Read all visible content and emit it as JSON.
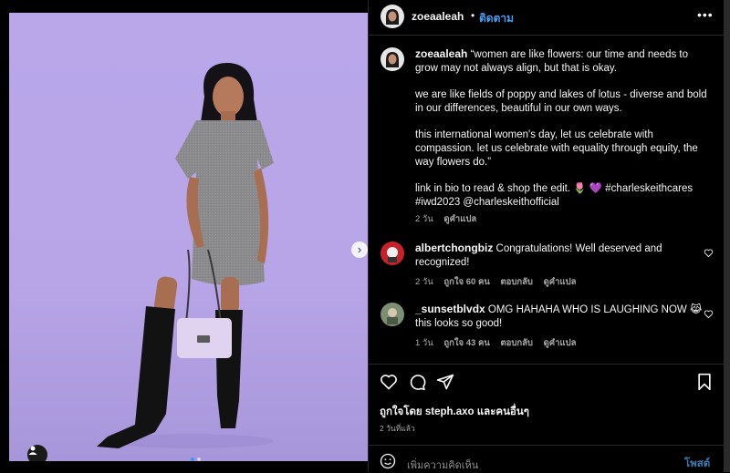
{
  "post": {
    "username": "zoeaaleah",
    "follow_label": "ติดตาม",
    "more_label": "•••",
    "dot_sep": "•"
  },
  "caption": {
    "username": "zoeaaleah",
    "p1": "“women are like flowers: our time and needs to grow may not always align, but that is okay.",
    "p2": "we are like fields of poppy and lakes of lotus - diverse and bold in our differences, beautiful in our own ways.",
    "p3": "this international women's day, let us celebrate with compassion. let us celebrate with equality through equity, the way flowers do.”",
    "p4": "link in bio to read & shop the edit. 🌷 💜 #charleskeithcares #iwd2023 @charleskeithofficial",
    "time": "2 วัน",
    "translate": "ดูคำแปล"
  },
  "comments": [
    {
      "username": "albertchongbiz",
      "text": "Congratulations! Well deserved and recognized!",
      "time": "2 วัน",
      "likes": "ถูกใจ 60 คน",
      "reply": "ตอบกลับ",
      "translate": "ดูคำแปล"
    },
    {
      "username": "_sunsetblvdx",
      "text": "OMG HAHAHA WHO IS LAUGHING NOW 😹 this looks so good!",
      "time": "1 วัน",
      "likes": "ถูกใจ 43 คน",
      "reply": "ตอบกลับ",
      "translate": "ดูคำแปล"
    }
  ],
  "likes_line": {
    "prefix": "ถูกใจโดย ",
    "user": "steph.axo",
    "suffix": " และคนอื่นๆ"
  },
  "date_label": "2 วันที่แล้ว",
  "comment_box": {
    "placeholder": "เพิ่มความคิดเห็น",
    "post_label": "โพสต์"
  },
  "carousel": {
    "next_glyph": "›",
    "slide_count": 2,
    "active_slide": 1
  },
  "icons": [
    "user-tag-icon",
    "next-arrow-icon",
    "heart-icon",
    "comment-icon",
    "share-icon",
    "bookmark-icon",
    "emoji-icon",
    "more-icon"
  ],
  "colors": {
    "follow": "#4c9bf0",
    "post": "#3e78b0",
    "background": "#b9a7ea"
  }
}
